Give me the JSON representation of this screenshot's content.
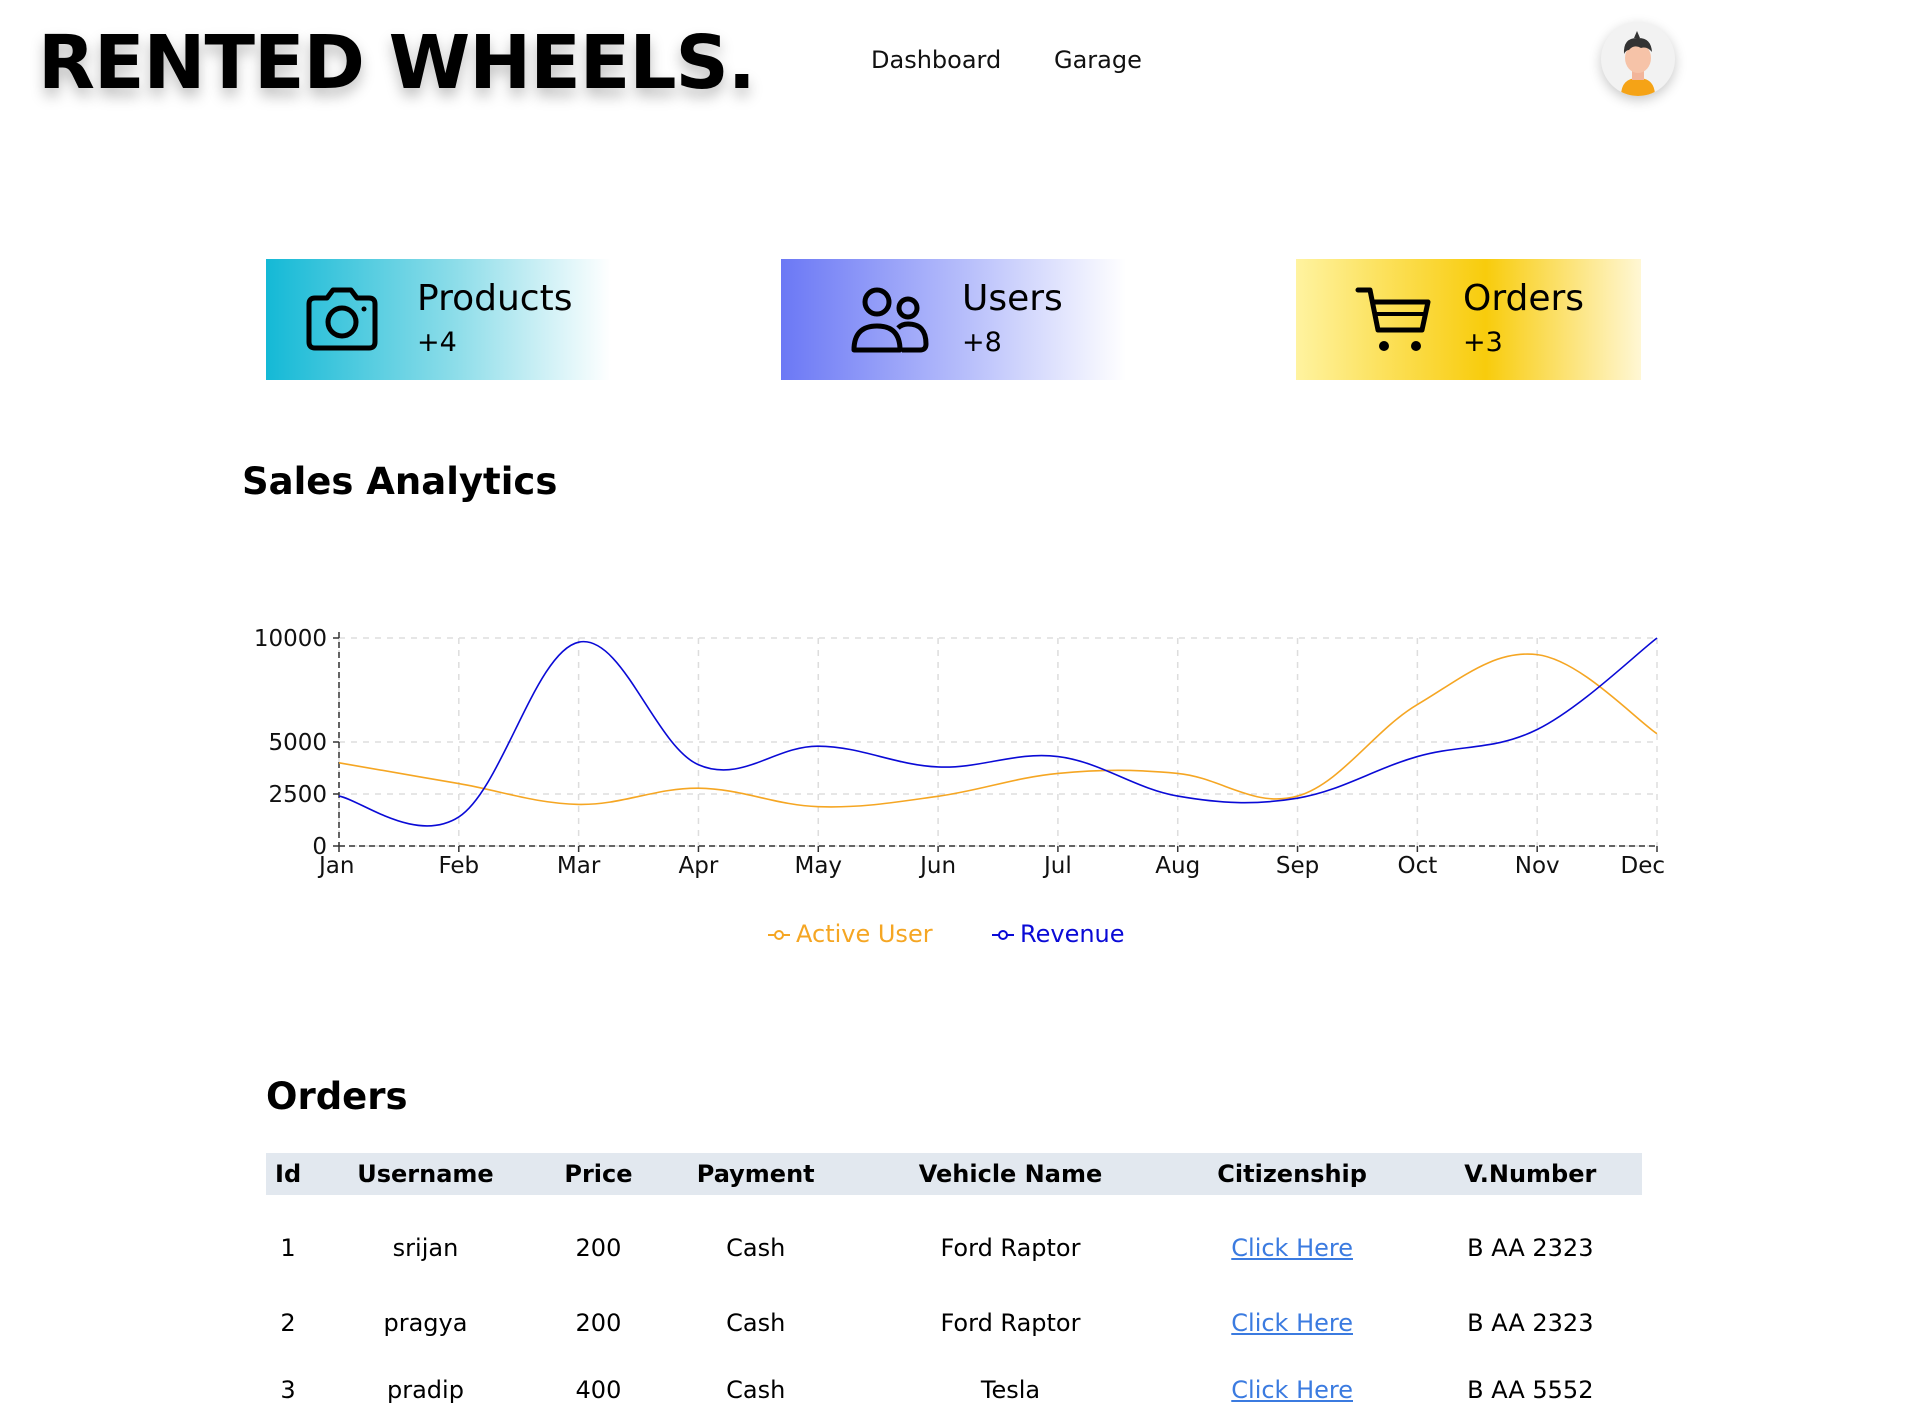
{
  "brand": {
    "logo_text": "RENTED WHEELS."
  },
  "nav": {
    "items": [
      {
        "label": "Dashboard"
      },
      {
        "label": "Garage"
      }
    ]
  },
  "cards": [
    {
      "title": "Products",
      "count": "+4",
      "icon": "camera-icon",
      "color": "#14b9d6"
    },
    {
      "title": "Users",
      "count": "+8",
      "icon": "users-icon",
      "color": "#6b78f5"
    },
    {
      "title": "Orders",
      "count": "+3",
      "icon": "cart-icon",
      "color": "#f8cc0c"
    }
  ],
  "analytics": {
    "title": "Sales Analytics"
  },
  "chart_data": {
    "type": "line",
    "categories": [
      "Jan",
      "Feb",
      "Mar",
      "Apr",
      "May",
      "Jun",
      "Jul",
      "Aug",
      "Sep",
      "Oct",
      "Nov",
      "Dec"
    ],
    "series": [
      {
        "name": "Active User",
        "color": "#f5a623",
        "values": [
          4000,
          3000,
          2000,
          2780,
          1890,
          2390,
          3490,
          3490,
          2400,
          6800,
          9200,
          5400
        ]
      },
      {
        "name": "Revenue",
        "color": "#0a0ad6",
        "values": [
          2400,
          1398,
          9800,
          3908,
          4800,
          3800,
          4300,
          2400,
          2300,
          4300,
          5600,
          10000
        ]
      }
    ],
    "yticks": [
      0,
      2500,
      5000,
      10000
    ],
    "ylim": [
      0,
      10000
    ],
    "grid": true,
    "legend": "bottom-center"
  },
  "orders_section": {
    "title": "Orders",
    "columns": [
      "Id",
      "Username",
      "Price",
      "Payment",
      "Vehicle Name",
      "Citizenship",
      "V.Number"
    ],
    "rows": [
      {
        "id": "1",
        "username": "srijan",
        "price": "200",
        "payment": "Cash",
        "vehicle": "Ford Raptor",
        "citizenship": "Click Here",
        "vnumber": "B AA 2323"
      },
      {
        "id": "2",
        "username": "pragya",
        "price": "200",
        "payment": "Cash",
        "vehicle": "Ford Raptor",
        "citizenship": "Click Here",
        "vnumber": "B AA 2323"
      },
      {
        "id": "3",
        "username": "pradip",
        "price": "400",
        "payment": "Cash",
        "vehicle": "Tesla",
        "citizenship": "Click Here",
        "vnumber": "B AA 5552"
      }
    ]
  }
}
